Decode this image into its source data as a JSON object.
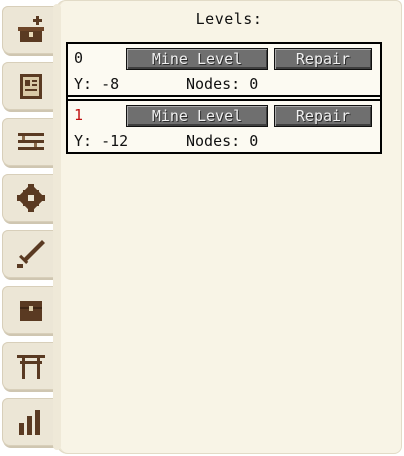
{
  "panel": {
    "title": "Levels:"
  },
  "tabs": [
    {
      "icon": "crown-chest-icon"
    },
    {
      "icon": "book-icon"
    },
    {
      "icon": "list-lines-icon"
    },
    {
      "icon": "gear-icon"
    },
    {
      "icon": "sword-icon"
    },
    {
      "icon": "chest-icon"
    },
    {
      "icon": "torii-gate-icon"
    },
    {
      "icon": "bar-chart-icon"
    }
  ],
  "levels": [
    {
      "index": "0",
      "mine_label": "Mine Level",
      "repair_label": "Repair",
      "y_text": "Y: -8",
      "nodes_text": "Nodes: 0",
      "selected": false
    },
    {
      "index": "1",
      "mine_label": "Mine Level",
      "repair_label": "Repair",
      "y_text": "Y: -12",
      "nodes_text": "Nodes: 0",
      "selected": true
    }
  ],
  "colors": {
    "parchment": "#f8f4e6",
    "tab": "#ece6d6",
    "icon_brown": "#5a3a22",
    "button_gray": "#6f6f6f",
    "selected_red": "#c01010"
  }
}
